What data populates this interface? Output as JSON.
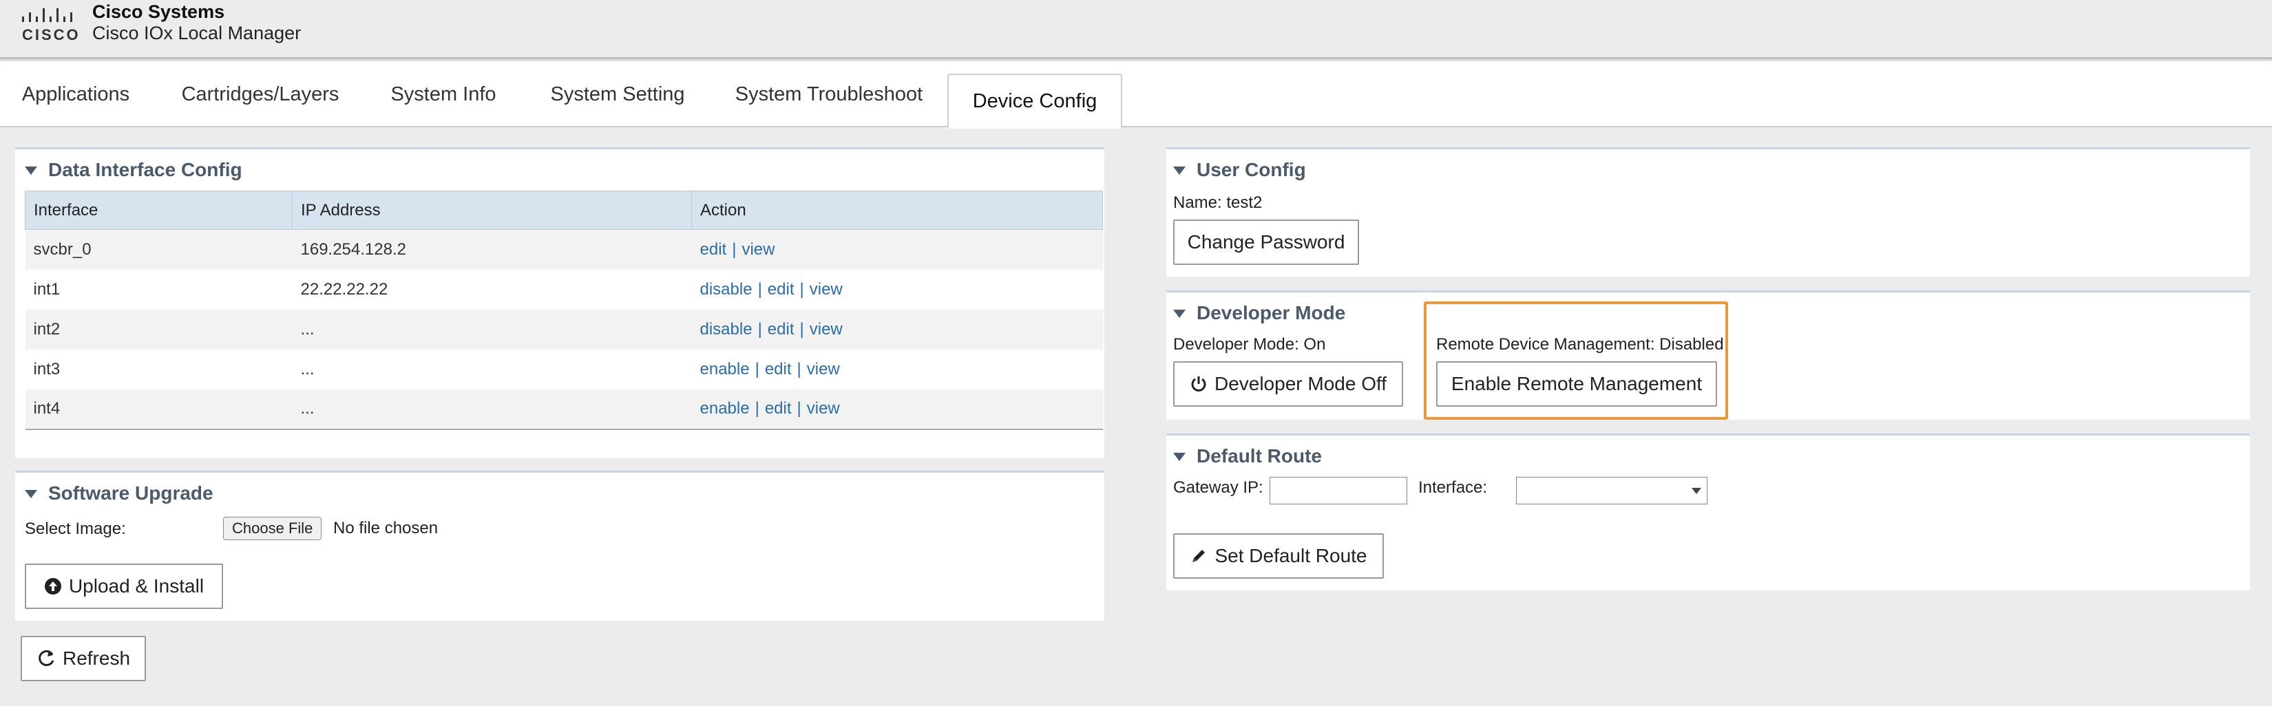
{
  "header": {
    "logo_text": "CISCO",
    "company": "Cisco Systems",
    "product": "Cisco IOx Local Manager"
  },
  "tabs": [
    {
      "label": "Applications"
    },
    {
      "label": "Cartridges/Layers"
    },
    {
      "label": "System Info"
    },
    {
      "label": "System Setting"
    },
    {
      "label": "System Troubleshoot"
    },
    {
      "label": "Device Config",
      "active": true
    }
  ],
  "data_interface": {
    "title": "Data Interface Config",
    "columns": [
      "Interface",
      "IP Address",
      "Action"
    ],
    "rows": [
      {
        "interface": "svcbr_0",
        "ip": "169.254.128.2",
        "actions": [
          "edit",
          "view"
        ]
      },
      {
        "interface": "int1",
        "ip": "22.22.22.22",
        "actions": [
          "disable",
          "edit",
          "view"
        ]
      },
      {
        "interface": "int2",
        "ip": "...",
        "actions": [
          "disable",
          "edit",
          "view"
        ]
      },
      {
        "interface": "int3",
        "ip": "...",
        "actions": [
          "enable",
          "edit",
          "view"
        ]
      },
      {
        "interface": "int4",
        "ip": "...",
        "actions": [
          "enable",
          "edit",
          "view"
        ]
      }
    ],
    "separator": "|"
  },
  "software_upgrade": {
    "title": "Software Upgrade",
    "select_label": "Select Image:",
    "choose_file": "Choose File",
    "no_file": "No file chosen",
    "upload_button": "Upload & Install"
  },
  "refresh_button": "Refresh",
  "user_config": {
    "title": "User Config",
    "name_label": "Name: test2",
    "change_password": "Change Password"
  },
  "developer_mode": {
    "title": "Developer Mode",
    "status": "Developer Mode: On",
    "toggle_button": "Developer Mode Off",
    "remote_status": "Remote Device Management: Disabled",
    "remote_button": "Enable Remote Management",
    "highlight_color": "#f0963a"
  },
  "default_route": {
    "title": "Default Route",
    "gateway_label": "Gateway IP:",
    "gateway_value": "",
    "interface_label": "Interface:",
    "interface_value": "",
    "set_button": "Set Default Route"
  },
  "colors": {
    "link": "#2a6da8",
    "table_header": "#d7e4ef",
    "panel_title": "#4a5a6a"
  }
}
